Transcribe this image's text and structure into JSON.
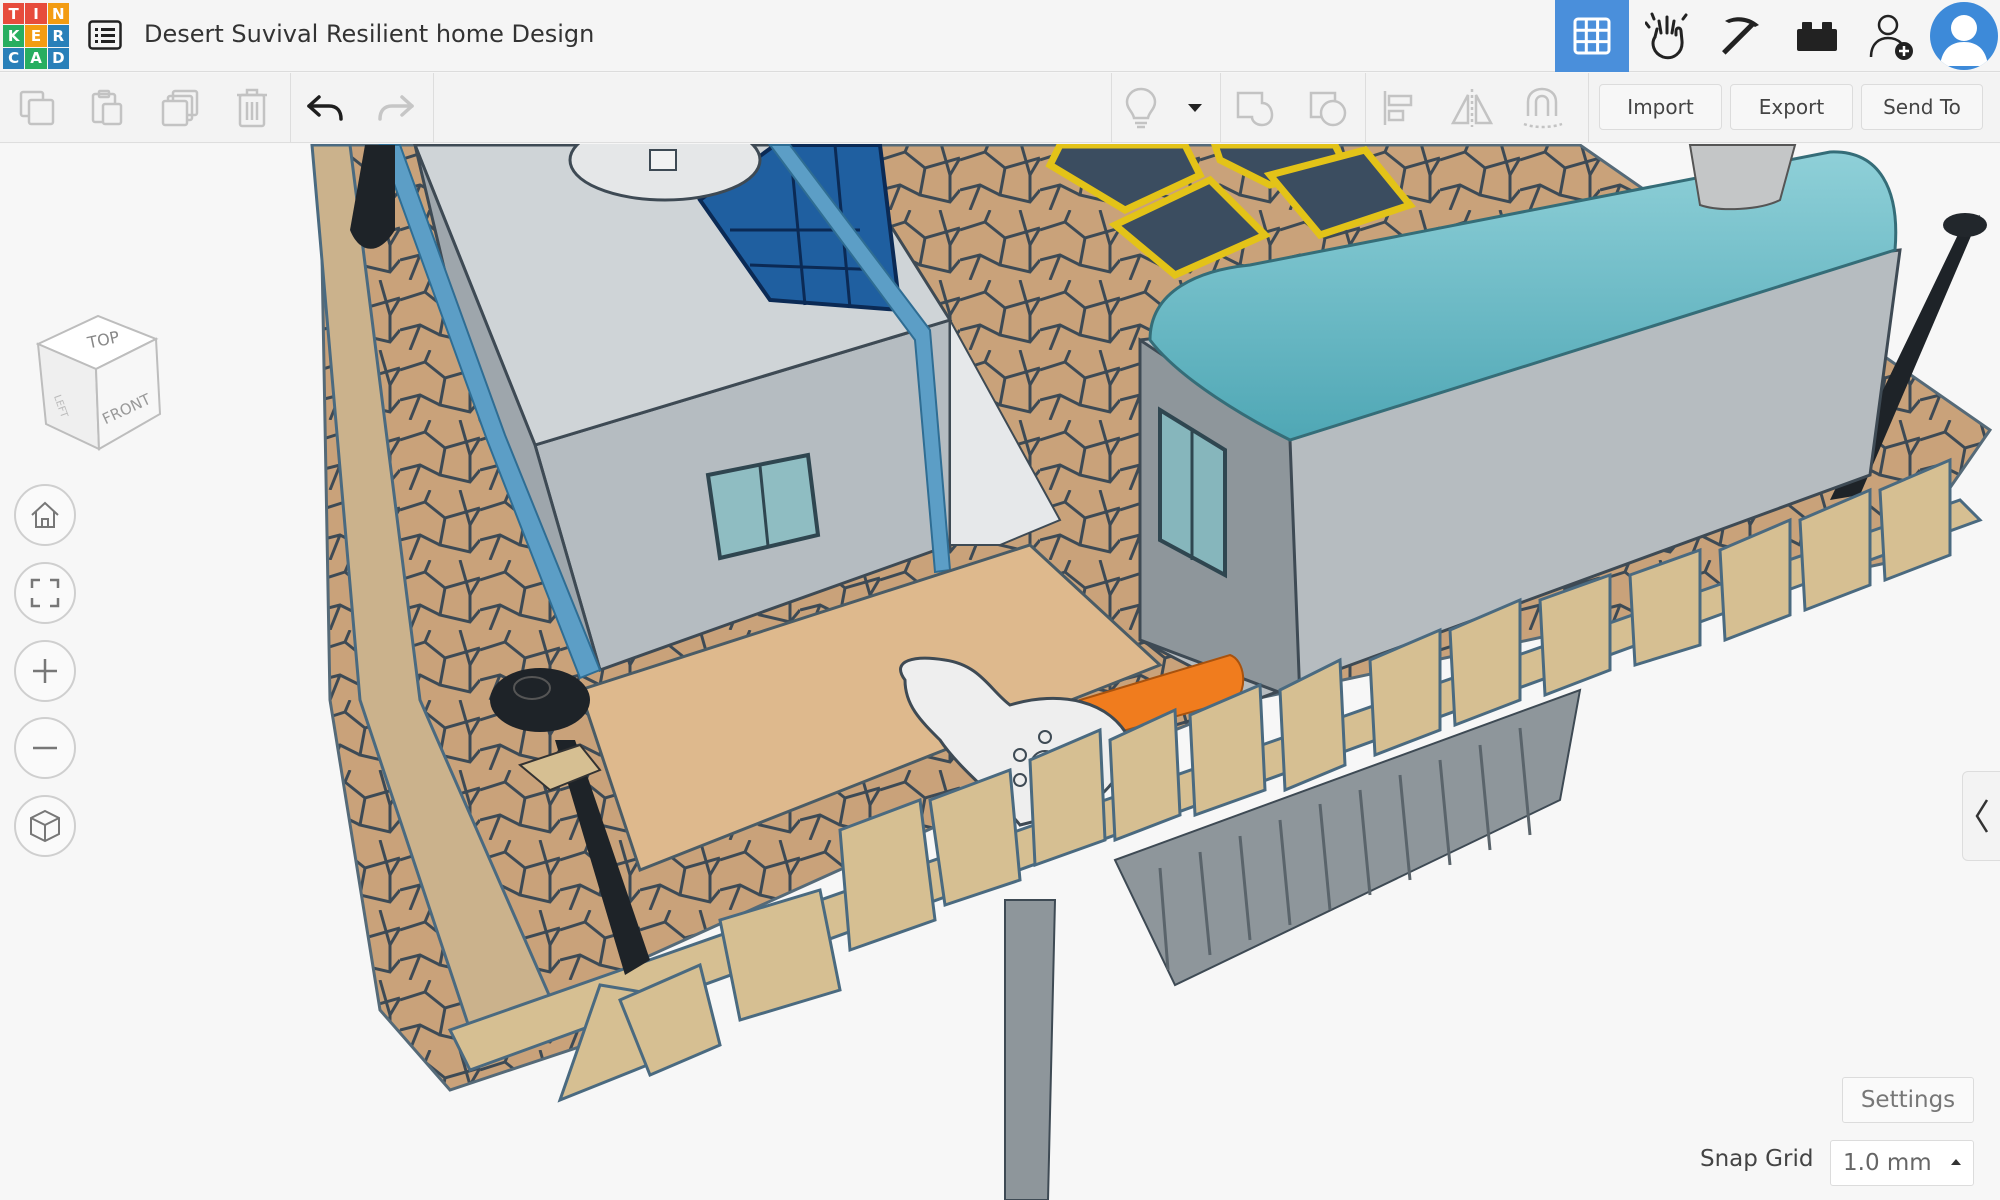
{
  "app": {
    "logo_letters": [
      "T",
      "I",
      "N",
      "K",
      "E",
      "R",
      "C",
      "A",
      "D"
    ],
    "logo_colors": [
      "#e74c3c",
      "#e74c3c",
      "#f39c12",
      "#27ae60",
      "#f39c12",
      "#2980b9",
      "#2980b9",
      "#27ae60",
      "#2980b9"
    ],
    "design_title": "Desert Suvival Resilient home Design"
  },
  "header": {
    "buttons": [
      {
        "name": "3d-design-view",
        "icon": "grid-icon",
        "active": true
      },
      {
        "name": "sim-lab-view",
        "icon": "hand-icon",
        "active": false
      },
      {
        "name": "blocks-view",
        "icon": "pickaxe-icon",
        "active": false
      },
      {
        "name": "bricks-view",
        "icon": "brick-icon",
        "active": false
      },
      {
        "name": "invite",
        "icon": "add-user-icon",
        "active": false
      }
    ],
    "accent_color": "#4a8fdb"
  },
  "toolbar": {
    "icons": [
      "copy-icon",
      "paste-icon",
      "duplicate-icon",
      "delete-icon",
      "undo-icon",
      "redo-icon",
      "light-bulb-icon",
      "dropdown-caret-icon",
      "group-icon",
      "ungroup-icon",
      "align-icon",
      "mirror-icon",
      "cruise-icon"
    ],
    "import_label": "Import",
    "export_label": "Export",
    "send_to_label": "Send To"
  },
  "view_cube": {
    "top_label": "TOP",
    "front_label": "FRONT",
    "left_label": "LEFT"
  },
  "view_controls": [
    "home-icon",
    "fit-view-icon",
    "zoom-in-icon",
    "zoom-out-icon",
    "ortho-view-icon"
  ],
  "footer": {
    "settings_label": "Settings",
    "snap_grid_label": "Snap Grid",
    "snap_grid_value": "1.0 mm"
  }
}
